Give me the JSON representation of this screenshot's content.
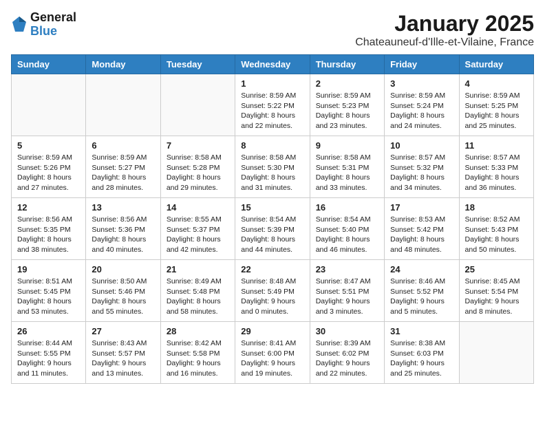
{
  "logo": {
    "line1": "General",
    "line2": "Blue"
  },
  "title": "January 2025",
  "location": "Chateauneuf-d'Ille-et-Vilaine, France",
  "headers": [
    "Sunday",
    "Monday",
    "Tuesday",
    "Wednesday",
    "Thursday",
    "Friday",
    "Saturday"
  ],
  "weeks": [
    [
      {
        "day": "",
        "lines": []
      },
      {
        "day": "",
        "lines": []
      },
      {
        "day": "",
        "lines": []
      },
      {
        "day": "1",
        "lines": [
          "Sunrise: 8:59 AM",
          "Sunset: 5:22 PM",
          "Daylight: 8 hours",
          "and 22 minutes."
        ]
      },
      {
        "day": "2",
        "lines": [
          "Sunrise: 8:59 AM",
          "Sunset: 5:23 PM",
          "Daylight: 8 hours",
          "and 23 minutes."
        ]
      },
      {
        "day": "3",
        "lines": [
          "Sunrise: 8:59 AM",
          "Sunset: 5:24 PM",
          "Daylight: 8 hours",
          "and 24 minutes."
        ]
      },
      {
        "day": "4",
        "lines": [
          "Sunrise: 8:59 AM",
          "Sunset: 5:25 PM",
          "Daylight: 8 hours",
          "and 25 minutes."
        ]
      }
    ],
    [
      {
        "day": "5",
        "lines": [
          "Sunrise: 8:59 AM",
          "Sunset: 5:26 PM",
          "Daylight: 8 hours",
          "and 27 minutes."
        ]
      },
      {
        "day": "6",
        "lines": [
          "Sunrise: 8:59 AM",
          "Sunset: 5:27 PM",
          "Daylight: 8 hours",
          "and 28 minutes."
        ]
      },
      {
        "day": "7",
        "lines": [
          "Sunrise: 8:58 AM",
          "Sunset: 5:28 PM",
          "Daylight: 8 hours",
          "and 29 minutes."
        ]
      },
      {
        "day": "8",
        "lines": [
          "Sunrise: 8:58 AM",
          "Sunset: 5:30 PM",
          "Daylight: 8 hours",
          "and 31 minutes."
        ]
      },
      {
        "day": "9",
        "lines": [
          "Sunrise: 8:58 AM",
          "Sunset: 5:31 PM",
          "Daylight: 8 hours",
          "and 33 minutes."
        ]
      },
      {
        "day": "10",
        "lines": [
          "Sunrise: 8:57 AM",
          "Sunset: 5:32 PM",
          "Daylight: 8 hours",
          "and 34 minutes."
        ]
      },
      {
        "day": "11",
        "lines": [
          "Sunrise: 8:57 AM",
          "Sunset: 5:33 PM",
          "Daylight: 8 hours",
          "and 36 minutes."
        ]
      }
    ],
    [
      {
        "day": "12",
        "lines": [
          "Sunrise: 8:56 AM",
          "Sunset: 5:35 PM",
          "Daylight: 8 hours",
          "and 38 minutes."
        ]
      },
      {
        "day": "13",
        "lines": [
          "Sunrise: 8:56 AM",
          "Sunset: 5:36 PM",
          "Daylight: 8 hours",
          "and 40 minutes."
        ]
      },
      {
        "day": "14",
        "lines": [
          "Sunrise: 8:55 AM",
          "Sunset: 5:37 PM",
          "Daylight: 8 hours",
          "and 42 minutes."
        ]
      },
      {
        "day": "15",
        "lines": [
          "Sunrise: 8:54 AM",
          "Sunset: 5:39 PM",
          "Daylight: 8 hours",
          "and 44 minutes."
        ]
      },
      {
        "day": "16",
        "lines": [
          "Sunrise: 8:54 AM",
          "Sunset: 5:40 PM",
          "Daylight: 8 hours",
          "and 46 minutes."
        ]
      },
      {
        "day": "17",
        "lines": [
          "Sunrise: 8:53 AM",
          "Sunset: 5:42 PM",
          "Daylight: 8 hours",
          "and 48 minutes."
        ]
      },
      {
        "day": "18",
        "lines": [
          "Sunrise: 8:52 AM",
          "Sunset: 5:43 PM",
          "Daylight: 8 hours",
          "and 50 minutes."
        ]
      }
    ],
    [
      {
        "day": "19",
        "lines": [
          "Sunrise: 8:51 AM",
          "Sunset: 5:45 PM",
          "Daylight: 8 hours",
          "and 53 minutes."
        ]
      },
      {
        "day": "20",
        "lines": [
          "Sunrise: 8:50 AM",
          "Sunset: 5:46 PM",
          "Daylight: 8 hours",
          "and 55 minutes."
        ]
      },
      {
        "day": "21",
        "lines": [
          "Sunrise: 8:49 AM",
          "Sunset: 5:48 PM",
          "Daylight: 8 hours",
          "and 58 minutes."
        ]
      },
      {
        "day": "22",
        "lines": [
          "Sunrise: 8:48 AM",
          "Sunset: 5:49 PM",
          "Daylight: 9 hours",
          "and 0 minutes."
        ]
      },
      {
        "day": "23",
        "lines": [
          "Sunrise: 8:47 AM",
          "Sunset: 5:51 PM",
          "Daylight: 9 hours",
          "and 3 minutes."
        ]
      },
      {
        "day": "24",
        "lines": [
          "Sunrise: 8:46 AM",
          "Sunset: 5:52 PM",
          "Daylight: 9 hours",
          "and 5 minutes."
        ]
      },
      {
        "day": "25",
        "lines": [
          "Sunrise: 8:45 AM",
          "Sunset: 5:54 PM",
          "Daylight: 9 hours",
          "and 8 minutes."
        ]
      }
    ],
    [
      {
        "day": "26",
        "lines": [
          "Sunrise: 8:44 AM",
          "Sunset: 5:55 PM",
          "Daylight: 9 hours",
          "and 11 minutes."
        ]
      },
      {
        "day": "27",
        "lines": [
          "Sunrise: 8:43 AM",
          "Sunset: 5:57 PM",
          "Daylight: 9 hours",
          "and 13 minutes."
        ]
      },
      {
        "day": "28",
        "lines": [
          "Sunrise: 8:42 AM",
          "Sunset: 5:58 PM",
          "Daylight: 9 hours",
          "and 16 minutes."
        ]
      },
      {
        "day": "29",
        "lines": [
          "Sunrise: 8:41 AM",
          "Sunset: 6:00 PM",
          "Daylight: 9 hours",
          "and 19 minutes."
        ]
      },
      {
        "day": "30",
        "lines": [
          "Sunrise: 8:39 AM",
          "Sunset: 6:02 PM",
          "Daylight: 9 hours",
          "and 22 minutes."
        ]
      },
      {
        "day": "31",
        "lines": [
          "Sunrise: 8:38 AM",
          "Sunset: 6:03 PM",
          "Daylight: 9 hours",
          "and 25 minutes."
        ]
      },
      {
        "day": "",
        "lines": []
      }
    ]
  ]
}
